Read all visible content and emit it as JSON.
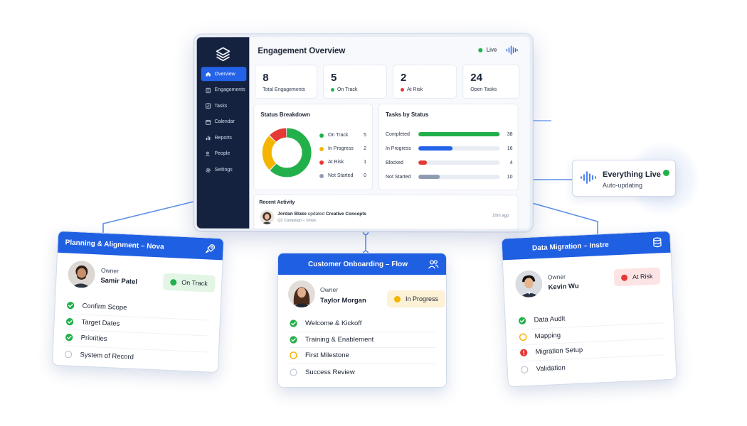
{
  "dashboard": {
    "title": "Engagement Overview",
    "live_label": "Live",
    "nav": [
      {
        "label": "Overview",
        "icon": "home-icon",
        "active": true
      },
      {
        "label": "Engagements",
        "icon": "clipboard-icon"
      },
      {
        "label": "Tasks",
        "icon": "checkbox-icon"
      },
      {
        "label": "Calendar",
        "icon": "calendar-icon"
      },
      {
        "label": "Reports",
        "icon": "bar-chart-icon"
      },
      {
        "label": "People",
        "icon": "people-icon"
      },
      {
        "label": "Settings",
        "icon": "gear-icon"
      }
    ],
    "stats": [
      {
        "value": "8",
        "label": "Total Engagements"
      },
      {
        "value": "5",
        "label": "On Track",
        "dot": "#22b04b"
      },
      {
        "value": "2",
        "label": "At Risk",
        "dot": "#e53935"
      },
      {
        "value": "24",
        "label": "Open Tasks"
      }
    ],
    "status_breakdown": {
      "title": "Status Breakdown",
      "items": [
        {
          "label": "On Track",
          "value": "5",
          "color": "#22b04b"
        },
        {
          "label": "In Progress",
          "value": "2",
          "color": "#f4b400"
        },
        {
          "label": "At Risk",
          "value": "1",
          "color": "#e53935"
        },
        {
          "label": "Not Started",
          "value": "0",
          "color": "#8f9bb3"
        }
      ]
    },
    "tasks_by_status": {
      "title": "Tasks by Status",
      "max": 38,
      "items": [
        {
          "label": "Completed",
          "value": "38",
          "color": "#22b04b"
        },
        {
          "label": "In Progress",
          "value": "16",
          "color": "#2462e8"
        },
        {
          "label": "Blocked",
          "value": "4",
          "color": "#e53935"
        },
        {
          "label": "Not Started",
          "value": "10",
          "color": "#8f9bb3"
        }
      ]
    },
    "activity": {
      "title": "Recent Activity",
      "actor": "Jordan Blake",
      "verb": "updated",
      "target": "Creative Concepts",
      "meta": "Q2 Campaign – Stripe",
      "time": "10m ago"
    }
  },
  "live_pill": {
    "title": "Everything Live",
    "subtitle": "Auto-updating"
  },
  "cards": [
    {
      "title": "Planning & Alignment – Nova",
      "icon": "rocket-icon",
      "owner_label": "Owner",
      "owner_name": "Samir Patel",
      "status": "On Track",
      "status_color": "#22b04b",
      "status_bg": "#e3f6e6",
      "items": [
        {
          "label": "Confirm Scope",
          "state": "done"
        },
        {
          "label": "Target Dates",
          "state": "done"
        },
        {
          "label": "Priorities",
          "state": "done"
        },
        {
          "label": "System of Record",
          "state": "todo"
        }
      ]
    },
    {
      "title": "Customer Onboarding – Flow",
      "icon": "users-icon",
      "owner_label": "Owner",
      "owner_name": "Taylor Morgan",
      "status": "In Progress",
      "status_color": "#f4b400",
      "status_bg": "#fdf1d6",
      "items": [
        {
          "label": "Welcome & Kickoff",
          "state": "done"
        },
        {
          "label": "Training & Enablement",
          "state": "done"
        },
        {
          "label": "First Milestone",
          "state": "progress"
        },
        {
          "label": "Success Review",
          "state": "todo"
        }
      ]
    },
    {
      "title": "Data Migration – Instre",
      "icon": "database-icon",
      "owner_label": "Owner",
      "owner_name": "Kevin Wu",
      "status": "At Risk",
      "status_color": "#e53935",
      "status_bg": "#fde4e4",
      "items": [
        {
          "label": "Data Audit",
          "state": "done"
        },
        {
          "label": "Mapping",
          "state": "progress"
        },
        {
          "label": "Migration Setup",
          "state": "alert"
        },
        {
          "label": "Validation",
          "state": "todo"
        }
      ]
    }
  ]
}
